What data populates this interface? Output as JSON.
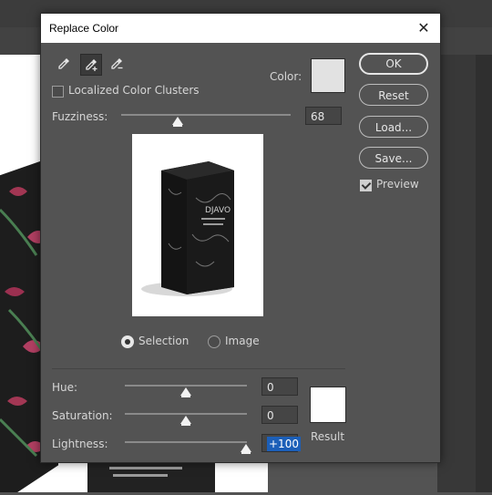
{
  "dialog": {
    "title": "Replace Color",
    "close_symbol": "✕",
    "eyedroppers": [
      {
        "name": "eyedropper-icon",
        "active": false
      },
      {
        "name": "eyedropper-add-icon",
        "active": true
      },
      {
        "name": "eyedropper-subtract-icon",
        "active": false
      }
    ],
    "color_label": "Color:",
    "color_swatch": "#e2e2e2",
    "localized_label": "Localized Color Clusters",
    "localized_checked": false,
    "fuzziness": {
      "label": "Fuzziness:",
      "value": "68",
      "fraction": 0.34
    },
    "selection_label": "Selection",
    "image_label": "Image",
    "mode": "Selection",
    "hue": {
      "label": "Hue:",
      "value": "0",
      "fraction": 0.5
    },
    "saturation": {
      "label": "Saturation:",
      "value": "0",
      "fraction": 0.5
    },
    "lightness": {
      "label": "Lightness:",
      "value": "+100",
      "fraction": 1.0
    },
    "result_label": "Result",
    "result_swatch": "#ffffff",
    "buttons": {
      "ok": "OK",
      "reset": "Reset",
      "load": "Load...",
      "save": "Save..."
    },
    "preview_label": "Preview",
    "preview_checked": true
  },
  "product_box": {
    "brand": "DJAVO"
  }
}
